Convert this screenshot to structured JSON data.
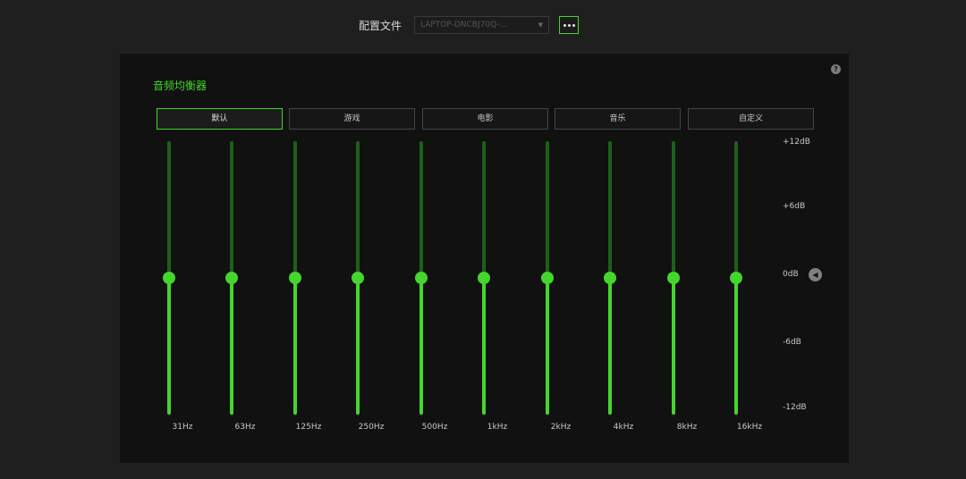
{
  "profile": {
    "label": "配置文件",
    "selected": "LAPTOP-DNCBJ70Q-...",
    "more_icon": "more-horizontal-icon"
  },
  "equalizer": {
    "title": "音频均衡器",
    "help_icon": "help-icon",
    "reset_icon": "reset-icon",
    "active_preset": 0,
    "presets": [
      {
        "label": "默认"
      },
      {
        "label": "游戏"
      },
      {
        "label": "电影"
      },
      {
        "label": "音乐"
      },
      {
        "label": "自定义"
      }
    ],
    "db_range": [
      -12,
      12
    ],
    "db_labels": [
      "+12dB",
      "+6dB",
      "0dB",
      "-6dB",
      "-12dB"
    ],
    "db_values": [
      12,
      6,
      0,
      -6,
      -12
    ],
    "bands": [
      {
        "label": "31Hz",
        "value": 0
      },
      {
        "label": "63Hz",
        "value": 0
      },
      {
        "label": "125Hz",
        "value": 0
      },
      {
        "label": "250Hz",
        "value": 0
      },
      {
        "label": "500Hz",
        "value": 0
      },
      {
        "label": "1kHz",
        "value": 0
      },
      {
        "label": "2kHz",
        "value": 0
      },
      {
        "label": "4kHz",
        "value": 0
      },
      {
        "label": "8kHz",
        "value": 0
      },
      {
        "label": "16kHz",
        "value": 0
      }
    ],
    "colors": {
      "accent": "#44d62c",
      "track_dim": "#1e5f1a"
    }
  }
}
